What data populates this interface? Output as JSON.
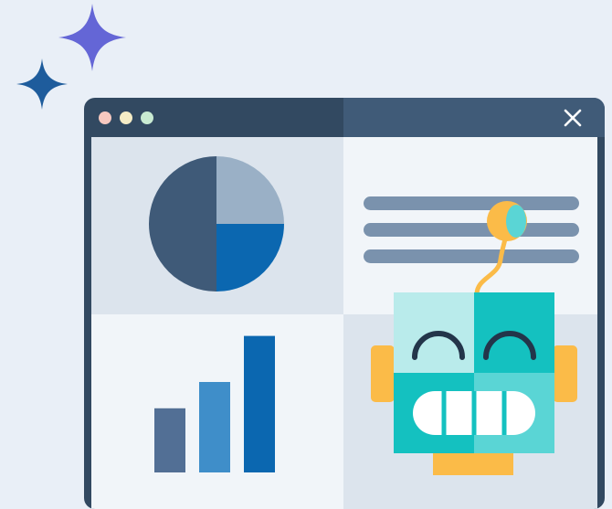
{
  "illustration": {
    "colors": {
      "background": "#e9eff7",
      "sparkle_large": "#6466d6",
      "sparkle_small": "#1e5c9c",
      "window_frame": "#324961",
      "titlebar_accent": "#405b78",
      "pie_dark": "#3f5a78",
      "pie_light": "#9ab0c6",
      "pie_blue": "#0b67b0",
      "text_lines": "#7a92ad",
      "robot_teal": "#14c1c0",
      "robot_light_teal": "#b9ebeb",
      "robot_mid_teal": "#5ad5d5",
      "robot_orange": "#fbbb48"
    },
    "icons": [
      "sparkle-icon",
      "window-dots-icon",
      "close-icon",
      "pie-chart-icon",
      "bar-chart-icon",
      "text-lines-icon",
      "robot-icon"
    ],
    "pie_chart": {
      "slices": [
        {
          "share": 0.5,
          "color": "#3f5a78"
        },
        {
          "share": 0.25,
          "color": "#9ab0c6"
        },
        {
          "share": 0.25,
          "color": "#0b67b0"
        }
      ]
    },
    "bar_chart": {
      "values": [
        3.9,
        5.5,
        8.3
      ],
      "colors": [
        "#526f95",
        "#3f8ec9",
        "#0b67b0"
      ]
    }
  }
}
